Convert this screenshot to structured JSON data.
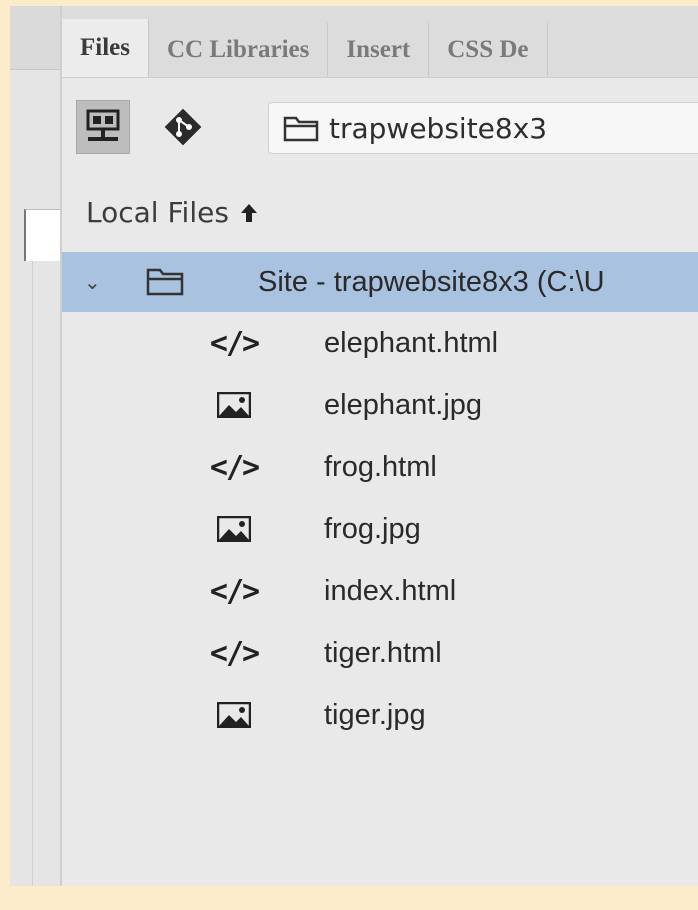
{
  "tabs": [
    {
      "label": "Files",
      "active": true
    },
    {
      "label": "CC Libraries",
      "active": false
    },
    {
      "label": "Insert",
      "active": false
    },
    {
      "label": "CSS De",
      "active": false
    }
  ],
  "toolbar": {
    "connect_icon": "network-server-icon",
    "git_icon": "git-icon",
    "site_select": "trapwebsite8x3"
  },
  "local_files": {
    "label": "Local Files",
    "sort_icon": "up-arrow-icon"
  },
  "tree": {
    "site_label": "Site - trapwebsite8x3 (C:\\U",
    "selected_color": "#a9c2df",
    "files": [
      {
        "name": "elephant.html",
        "type": "html"
      },
      {
        "name": "elephant.jpg",
        "type": "image"
      },
      {
        "name": "frog.html",
        "type": "html"
      },
      {
        "name": "frog.jpg",
        "type": "image"
      },
      {
        "name": "index.html",
        "type": "html"
      },
      {
        "name": "tiger.html",
        "type": "html"
      },
      {
        "name": "tiger.jpg",
        "type": "image"
      }
    ]
  }
}
